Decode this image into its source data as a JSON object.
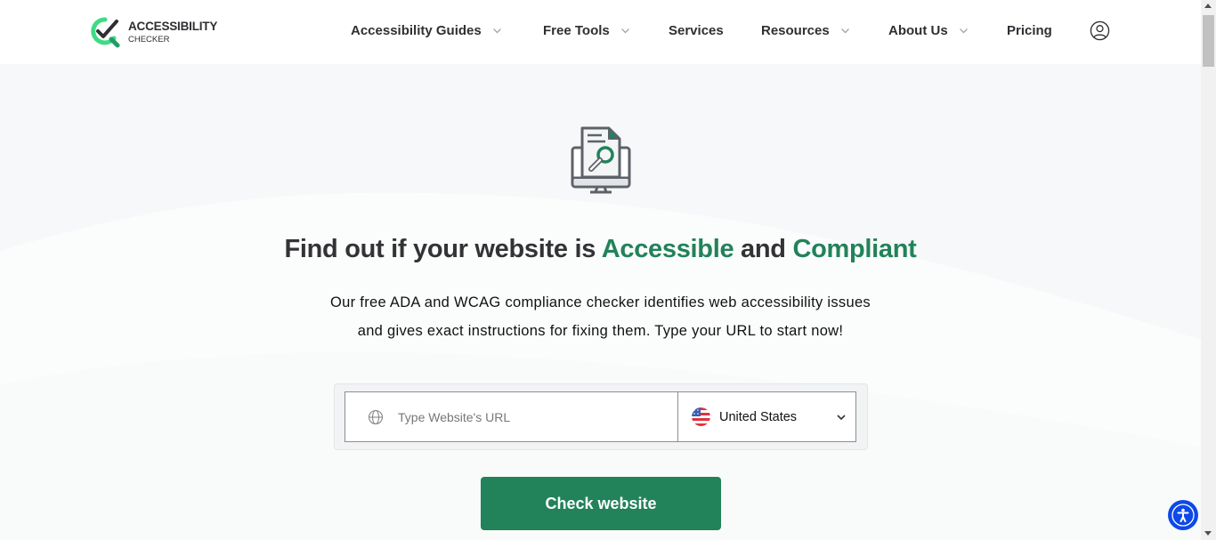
{
  "header": {
    "logo": {
      "title": "ACCESSIBILITY",
      "subtitle": "CHECKER"
    },
    "nav": [
      {
        "label": "Accessibility Guides",
        "has_dropdown": true
      },
      {
        "label": "Free Tools",
        "has_dropdown": true
      },
      {
        "label": "Services",
        "has_dropdown": false
      },
      {
        "label": "Resources",
        "has_dropdown": true
      },
      {
        "label": "About Us",
        "has_dropdown": true
      },
      {
        "label": "Pricing",
        "has_dropdown": false
      }
    ],
    "account_icon": "user-circle-icon"
  },
  "hero": {
    "icon": "monitor-document-search-icon",
    "title_part1": "Find out if your website is ",
    "title_highlight1": "Accessible",
    "title_part2": " and ",
    "title_highlight2": "Compliant",
    "subtitle_line1": "Our free ADA and WCAG compliance checker identifies web accessibility issues",
    "subtitle_line2": "and gives exact instructions for fixing them. Type your URL to start now!"
  },
  "form": {
    "url_placeholder": "Type Website's URL",
    "url_value": "",
    "country_selected": "United States",
    "submit_label": "Check website"
  },
  "accessibility_widget": {
    "icon": "accessibility-person-icon"
  },
  "colors": {
    "brand_green": "#22825a",
    "text_dark": "#2f2f33",
    "widget_blue": "#0f48e8"
  }
}
